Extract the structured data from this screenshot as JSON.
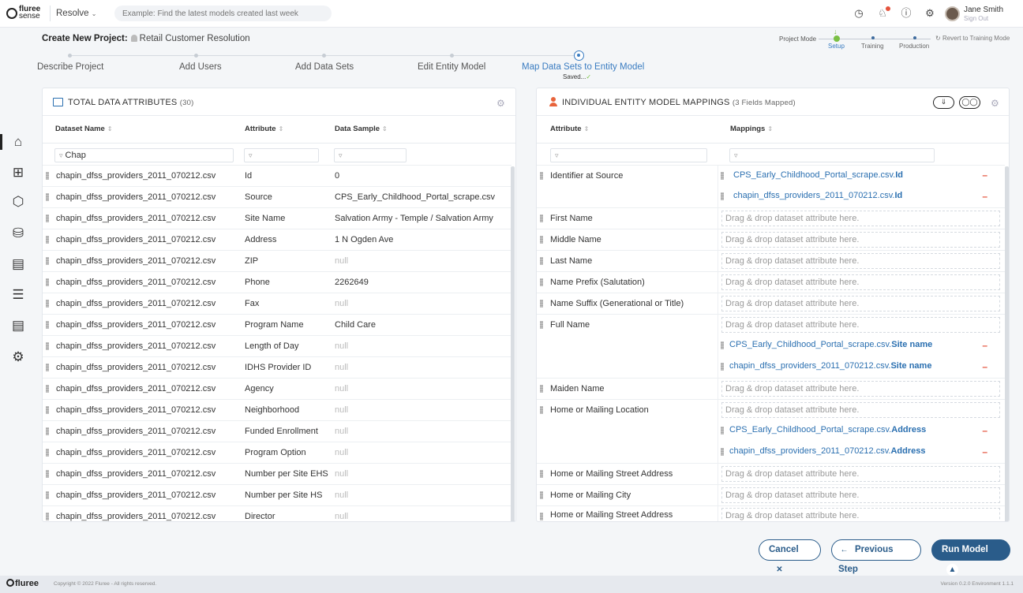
{
  "app": {
    "logo_primary": "fluree",
    "logo_secondary": "sense",
    "module_dropdown": "Resolve",
    "search_placeholder": "Example: Find the latest models created last week",
    "user_name": "Jane Smith",
    "sign_out": "Sign Out"
  },
  "project": {
    "title_prefix": "Create New Project:",
    "name": "Retail Customer Resolution"
  },
  "mode": {
    "label": "Project Mode",
    "steps": [
      "Setup",
      "Training",
      "Production"
    ],
    "active": "Setup",
    "revert": "Revert to Training Mode"
  },
  "wizard": {
    "steps": [
      "Describe Project",
      "Add Users",
      "Add Data Sets",
      "Edit Entity Model",
      "Map Data Sets to Entity Model"
    ],
    "active_index": 4,
    "saved": "Saved..."
  },
  "left_panel": {
    "title": "TOTAL DATA ATTRIBUTES",
    "count": "(30)",
    "columns": [
      "Dataset Name",
      "Attribute",
      "Data Sample"
    ],
    "filter_dataset": "Chap",
    "rows": [
      {
        "dataset": "chapin_dfss_providers_2011_070212.csv",
        "attribute": "Id",
        "sample": "0"
      },
      {
        "dataset": "chapin_dfss_providers_2011_070212.csv",
        "attribute": "Source",
        "sample": "CPS_Early_Childhood_Portal_scrape.csv"
      },
      {
        "dataset": "chapin_dfss_providers_2011_070212.csv",
        "attribute": "Site Name",
        "sample": "Salvation Army - Temple / Salvation Army"
      },
      {
        "dataset": "chapin_dfss_providers_2011_070212.csv",
        "attribute": "Address",
        "sample": "1 N Ogden Ave"
      },
      {
        "dataset": "chapin_dfss_providers_2011_070212.csv",
        "attribute": "ZIP",
        "sample": "null"
      },
      {
        "dataset": "chapin_dfss_providers_2011_070212.csv",
        "attribute": "Phone",
        "sample": "2262649"
      },
      {
        "dataset": "chapin_dfss_providers_2011_070212.csv",
        "attribute": "Fax",
        "sample": "null"
      },
      {
        "dataset": "chapin_dfss_providers_2011_070212.csv",
        "attribute": "Program Name",
        "sample": "Child Care"
      },
      {
        "dataset": "chapin_dfss_providers_2011_070212.csv",
        "attribute": "Length of Day",
        "sample": "null"
      },
      {
        "dataset": "chapin_dfss_providers_2011_070212.csv",
        "attribute": "IDHS Provider ID",
        "sample": "null"
      },
      {
        "dataset": "chapin_dfss_providers_2011_070212.csv",
        "attribute": "Agency",
        "sample": "null"
      },
      {
        "dataset": "chapin_dfss_providers_2011_070212.csv",
        "attribute": "Neighborhood",
        "sample": "null"
      },
      {
        "dataset": "chapin_dfss_providers_2011_070212.csv",
        "attribute": "Funded Enrollment",
        "sample": "null"
      },
      {
        "dataset": "chapin_dfss_providers_2011_070212.csv",
        "attribute": "Program Option",
        "sample": "null"
      },
      {
        "dataset": "chapin_dfss_providers_2011_070212.csv",
        "attribute": "Number per Site EHS",
        "sample": "null"
      },
      {
        "dataset": "chapin_dfss_providers_2011_070212.csv",
        "attribute": "Number per Site HS",
        "sample": "null"
      },
      {
        "dataset": "chapin_dfss_providers_2011_070212.csv",
        "attribute": "Director",
        "sample": "null"
      }
    ]
  },
  "right_panel": {
    "title": "INDIVIDUAL ENTITY MODEL MAPPINGS",
    "count": "(3 Fields Mapped)",
    "columns": [
      "Attribute",
      "Mappings"
    ],
    "drop_text": "Drag & drop dataset attribute here.",
    "mapping_1a_file": "CPS_Early_Childhood_Portal_scrape.csv.",
    "mapping_1a_field": "Id",
    "mapping_1b_file": "chapin_dfss_providers_2011_070212.csv.",
    "mapping_1b_field": "Id",
    "mapping_2a_file": "CPS_Early_Childhood_Portal_scrape.csv.",
    "mapping_2a_field": "Site name",
    "mapping_2b_file": "chapin_dfss_providers_2011_070212.csv.",
    "mapping_2b_field": "Site name",
    "mapping_3a_file": "CPS_Early_Childhood_Portal_scrape.csv.",
    "mapping_3a_field": "Address",
    "mapping_3b_file": "chapin_dfss_providers_2011_070212.csv.",
    "mapping_3b_field": "Address",
    "attrs": {
      "identifier": "Identifier at Source",
      "first_name": "First Name",
      "middle_name": "Middle Name",
      "last_name": "Last Name",
      "prefix": "Name Prefix (Salutation)",
      "suffix": "Name Suffix (Generational or Title)",
      "full_name": "Full Name",
      "maiden": "Maiden Name",
      "home_loc": "Home or Mailing Location",
      "home_street": "Home or Mailing Street Address",
      "home_city": "Home or Mailing City",
      "home_street2": "Home or Mailing Street Address"
    }
  },
  "actions": {
    "cancel": "Cancel",
    "previous": "Previous Step",
    "run": "Run Model"
  },
  "footer": {
    "logo": "fluree",
    "copyright": "Copyright © 2022 Fluree - All rights reserved.",
    "version": "Version 0.2.0   Environment 1.1.1"
  }
}
